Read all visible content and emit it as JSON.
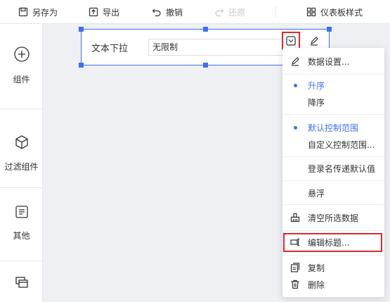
{
  "toolbar": {
    "save_as": "另存为",
    "export": "导出",
    "undo": "撤销",
    "redo": "还原",
    "dashboard_style": "仪表板样式"
  },
  "sidebar": {
    "components": "组件",
    "filter_components": "过滤组件",
    "other": "其他"
  },
  "widget": {
    "title": "文本下拉",
    "select_value": "无限制"
  },
  "menu": {
    "data_settings": "数据设置...",
    "ascending": "升序",
    "descending": "降序",
    "default_control_range": "默认控制范围",
    "custom_control_range": "自定义控制范围...",
    "login_name_default": "登录名传递默认值",
    "float": "悬浮",
    "clear_selection": "清空所选数据",
    "edit_title": "编辑标题...",
    "copy": "复制",
    "delete": "删除"
  },
  "colors": {
    "accent": "#3b6ff5",
    "highlight": "#e0282e"
  }
}
